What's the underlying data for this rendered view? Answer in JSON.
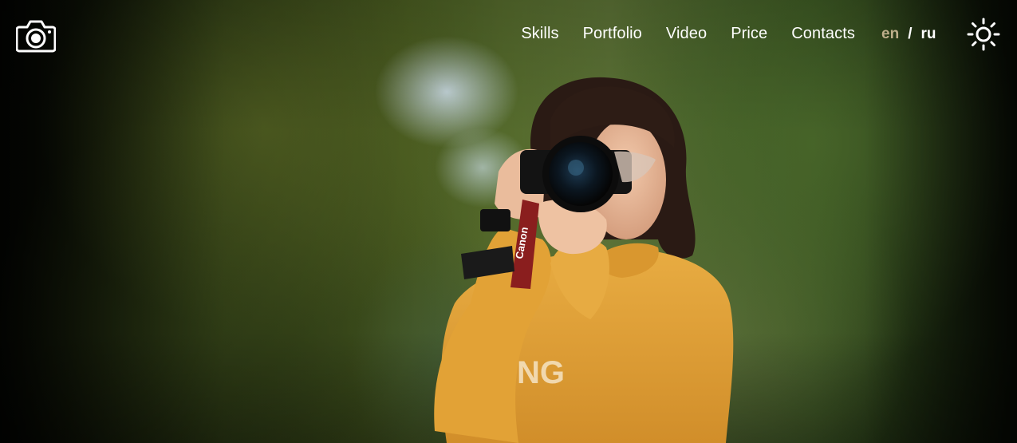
{
  "page": {
    "background_scene": "woman in mustard sweater photographing with a Canon camera in front of blurred trees",
    "colors": {
      "nav_text": "#ffffff",
      "lang_active": "#bdae8a",
      "sweater": "#e0a33c",
      "foliage": "#4c6022"
    }
  },
  "header": {
    "logo_icon": "camera-icon",
    "nav": [
      {
        "label": "Skills"
      },
      {
        "label": "Portfolio"
      },
      {
        "label": "Video"
      },
      {
        "label": "Price"
      },
      {
        "label": "Contacts"
      }
    ],
    "language": {
      "active": "en",
      "separator": "/",
      "other": "ru"
    },
    "theme_icon": "sun-icon"
  },
  "photo": {
    "camera_brand": "Canon",
    "sweater_text": "NG"
  }
}
